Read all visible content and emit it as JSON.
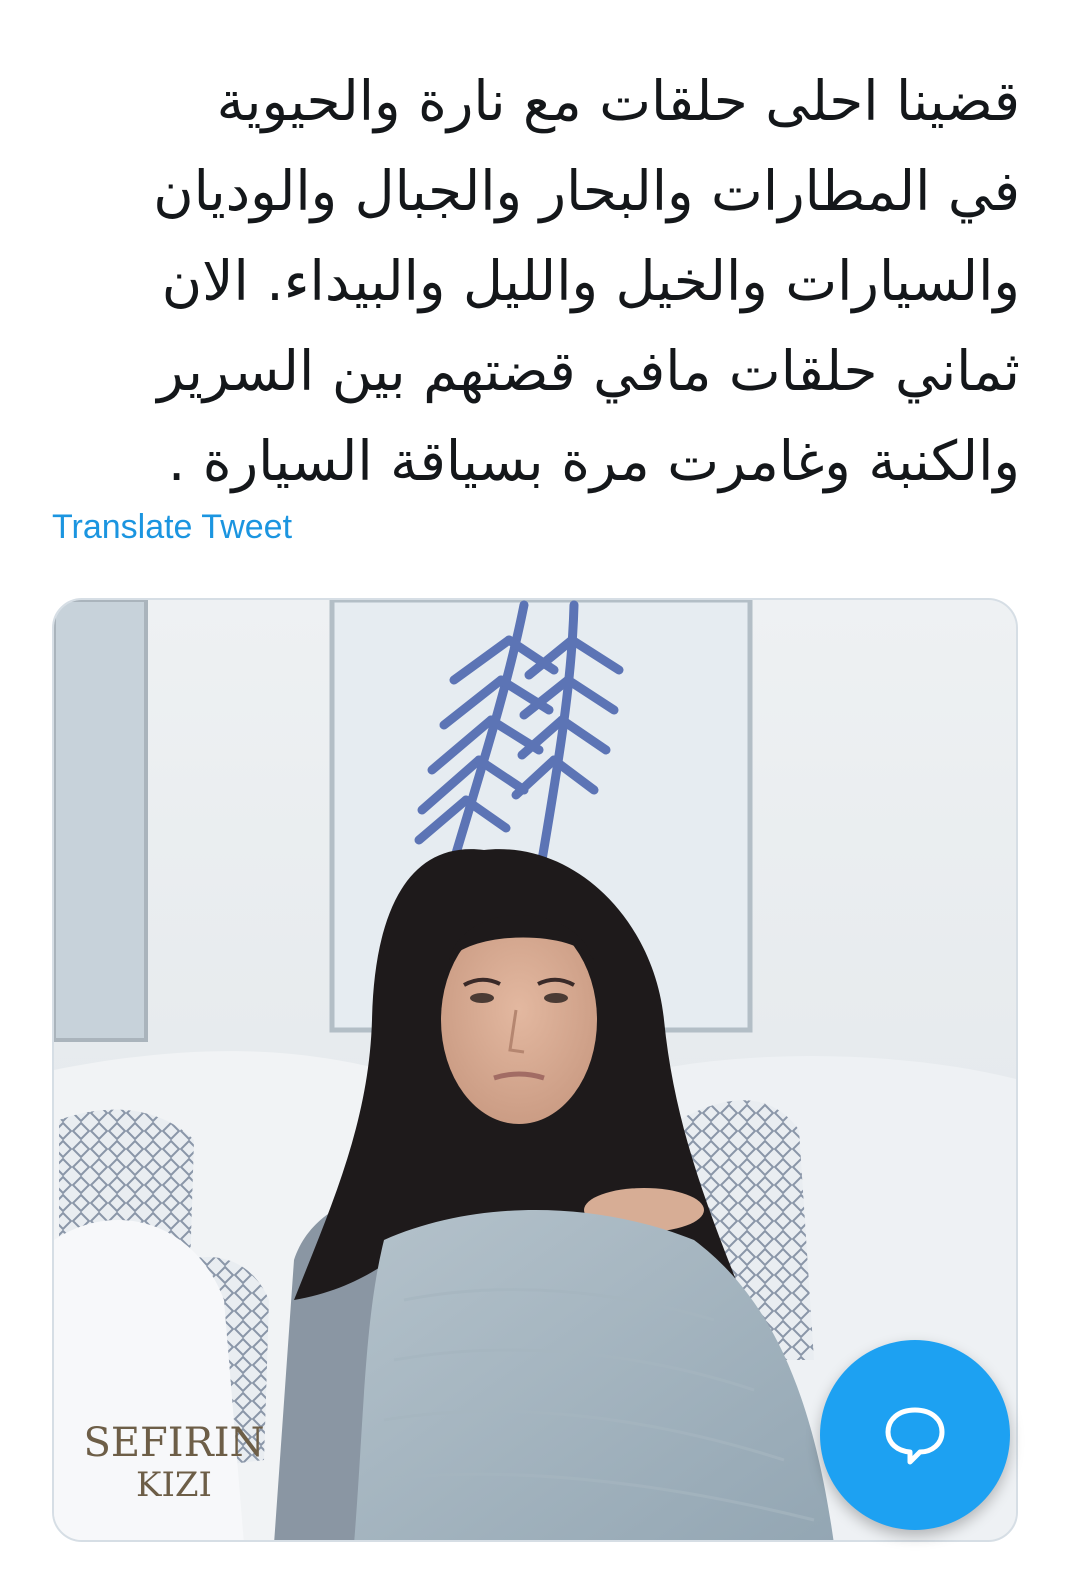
{
  "tweet": {
    "lines": [
      "قضينا احلى حلقات مع نارة والحيوية",
      "في المطارات والبحار والجبال والوديان",
      "والسيارات والخيل والليل والبيداء. الان",
      "ثماني حلقات مافي قضتهم بين السرير",
      "والكنبة وغامرت مرة بسياقة السيارة ."
    ],
    "translate_label": "Translate Tweet"
  },
  "media": {
    "watermark_line1": "SEFIRIN",
    "watermark_line2": "KIZI"
  },
  "fab": {
    "icon": "speech-bubble-icon"
  },
  "colors": {
    "link": "#1b95e0",
    "fab": "#1da1f2",
    "text": "#14171a"
  }
}
